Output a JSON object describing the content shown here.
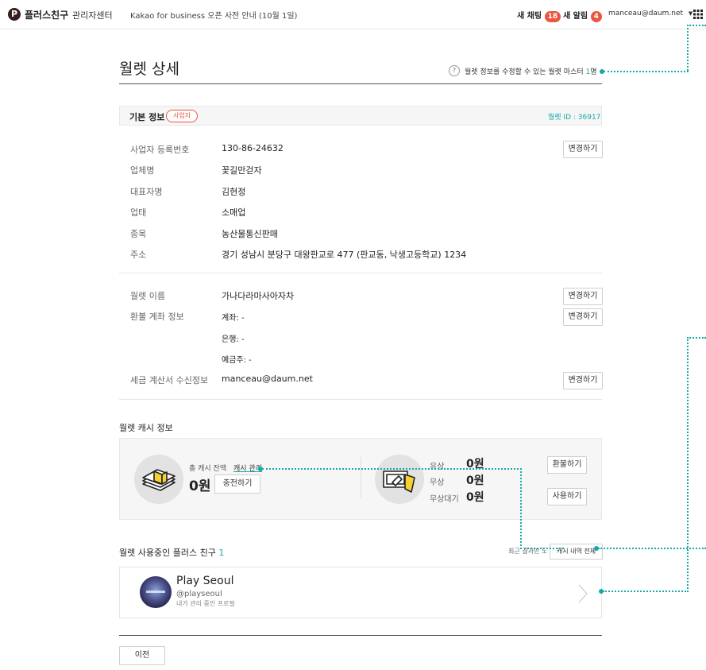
{
  "header": {
    "logo_mark": "P",
    "brand": "플러스친구",
    "brand_suffix": "관리자센터",
    "notice": "Kakao for business 오픈 사전 안내 (10월 1일)",
    "chat_label": "새 채팅",
    "chat_count": "18",
    "alert_label": "새 알림",
    "alert_count": "4",
    "account": "manceau@daum.net"
  },
  "page": {
    "title": "월렛 상세",
    "master_help_text": "월렛 정보를 수정할 수 있는 월렛 마스터",
    "master_count": "1",
    "master_unit": "명"
  },
  "basic_info": {
    "section_title": "기본 정보",
    "badge": "사업자",
    "wallet_id": "월렛 ID : 36917",
    "rows": [
      {
        "label": "사업자 등록번호",
        "value": "130-86-24632"
      },
      {
        "label": "업체명",
        "value": "꽃길만걷자"
      },
      {
        "label": "대표자명",
        "value": "김현정"
      },
      {
        "label": "업태",
        "value": "소매업"
      },
      {
        "label": "종목",
        "value": "농산물통신판매"
      },
      {
        "label": "주소",
        "value": "경기 성남시 분당구 대왕판교로 477 (판교동, 낙생고등학교) 1234"
      }
    ],
    "change_label": "변경하기"
  },
  "wallet_info": {
    "name_label": "월렛 이름",
    "name_value": "가나다라마사아자차",
    "refund_label": "환불 계좌 정보",
    "account_line": "계좌:  -",
    "bank_line": "은행:  -",
    "holder_line": "예금주:  -",
    "tax_label": "세금 계산서 수신정보",
    "tax_value": "manceau@daum.net",
    "change_label": "변경하기"
  },
  "cash": {
    "section_title": "월렛 캐시 정보",
    "total_label": "총 캐시 잔액",
    "manage_link": "캐시 관리",
    "total_value": "0원",
    "charge_button": "충전하기",
    "paid_label": "유상",
    "paid_value": "0원",
    "free_label": "무상",
    "free_value": "0원",
    "pending_label": "무상대기",
    "pending_value": "0원",
    "refund_button": "환불하기",
    "use_button": "사용하기"
  },
  "friends": {
    "section_title": "월렛 사용중인 플러스 친구",
    "count": "1",
    "recent_text": "최근 결과만 노",
    "history_button": "캐시 내역 전체",
    "profile_name": "Play Seoul",
    "profile_id": "@playseoul",
    "profile_sub": "내가 관리 중인 프로필"
  },
  "footer": {
    "back_button": "이전"
  }
}
